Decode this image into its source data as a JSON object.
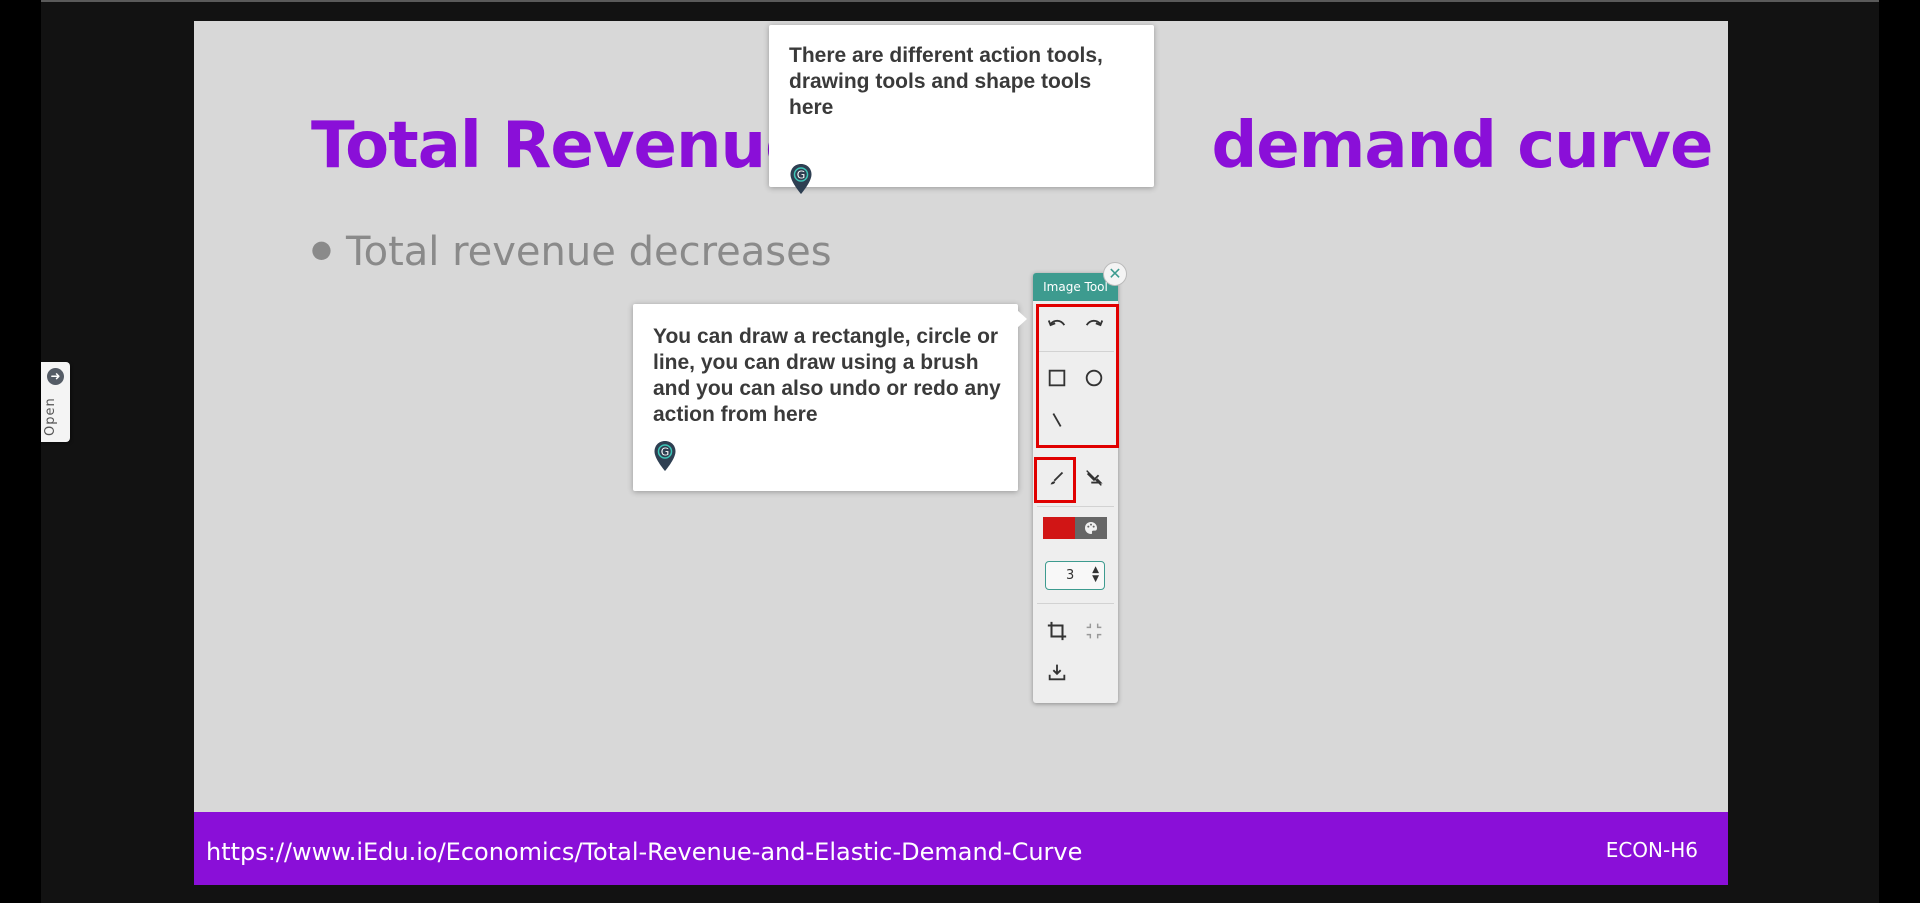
{
  "slide": {
    "title": "Total Revenue and Elastic demand curve",
    "title_visible_left": "Total Revenue",
    "title_visible_right": "demand curve",
    "bullet": "Total revenue decreases",
    "footer_url": "https://www.iEdu.io/Economics/Total-Revenue-and-Elastic-Demand-Curve",
    "footer_code": "ECON-H6"
  },
  "side_tab": {
    "label": "Open",
    "icon": "arrow-right-circle-icon"
  },
  "tooltips": {
    "top": "There are different action tools, drawing tools and shape tools here",
    "side": "You can draw a rectangle, circle or line, you can draw using a brush and you can also undo or redo any action from here"
  },
  "image_tool": {
    "title": "Image Tool",
    "close_icon": "close-icon",
    "stroke_width": "3",
    "color": "#d11515",
    "tools": [
      "undo-icon",
      "redo-icon",
      "rectangle-icon",
      "circle-icon",
      "line-icon",
      "brush-icon",
      "transform-icon",
      "color-palette-icon",
      "crop-icon",
      "collapse-icon",
      "download-icon"
    ]
  },
  "colors": {
    "accent_purple": "#8a0fd8",
    "tool_header": "#3d9b8f",
    "highlight_red": "#e00000",
    "slide_bg": "#d8d8d8"
  }
}
